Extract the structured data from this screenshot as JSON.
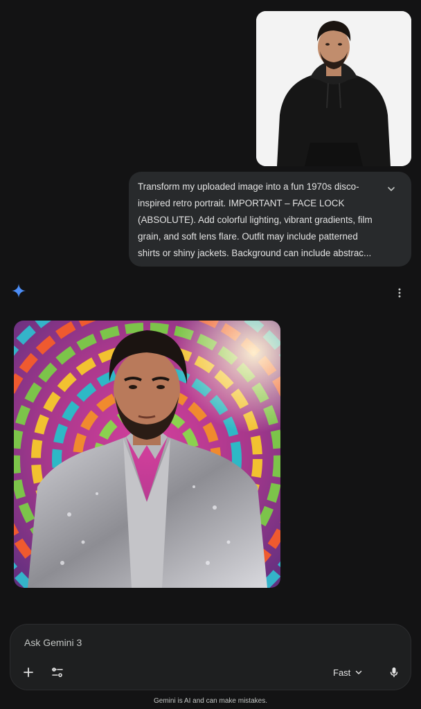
{
  "conversation": {
    "user_message": {
      "image_label": "uploaded portrait photo",
      "prompt": "Transform my uploaded image into a fun 1970s disco-inspired retro portrait. IMPORTANT – FACE LOCK (ABSOLUTE). Add colorful lighting, vibrant gradients, film grain, and soft lens flare. Outfit may include patterned shirts or shiny jackets. Background can include abstrac..."
    },
    "model_response": {
      "image_label": "generated 1970s disco retro portrait"
    }
  },
  "composer": {
    "placeholder": "Ask Gemini 3",
    "mode": "Fast"
  },
  "footer": {
    "disclaimer": "Gemini is AI and can make mistakes."
  },
  "colors": {
    "background": "#131314",
    "bubble": "#282a2c",
    "composer": "#1e1f20",
    "text": "#e3e3e3",
    "gemini_blue": "#4c8df6"
  },
  "icons": [
    "chevron-down-icon",
    "gemini-spark-icon",
    "more-vert-icon",
    "plus-icon",
    "tune-icon",
    "mic-icon"
  ]
}
